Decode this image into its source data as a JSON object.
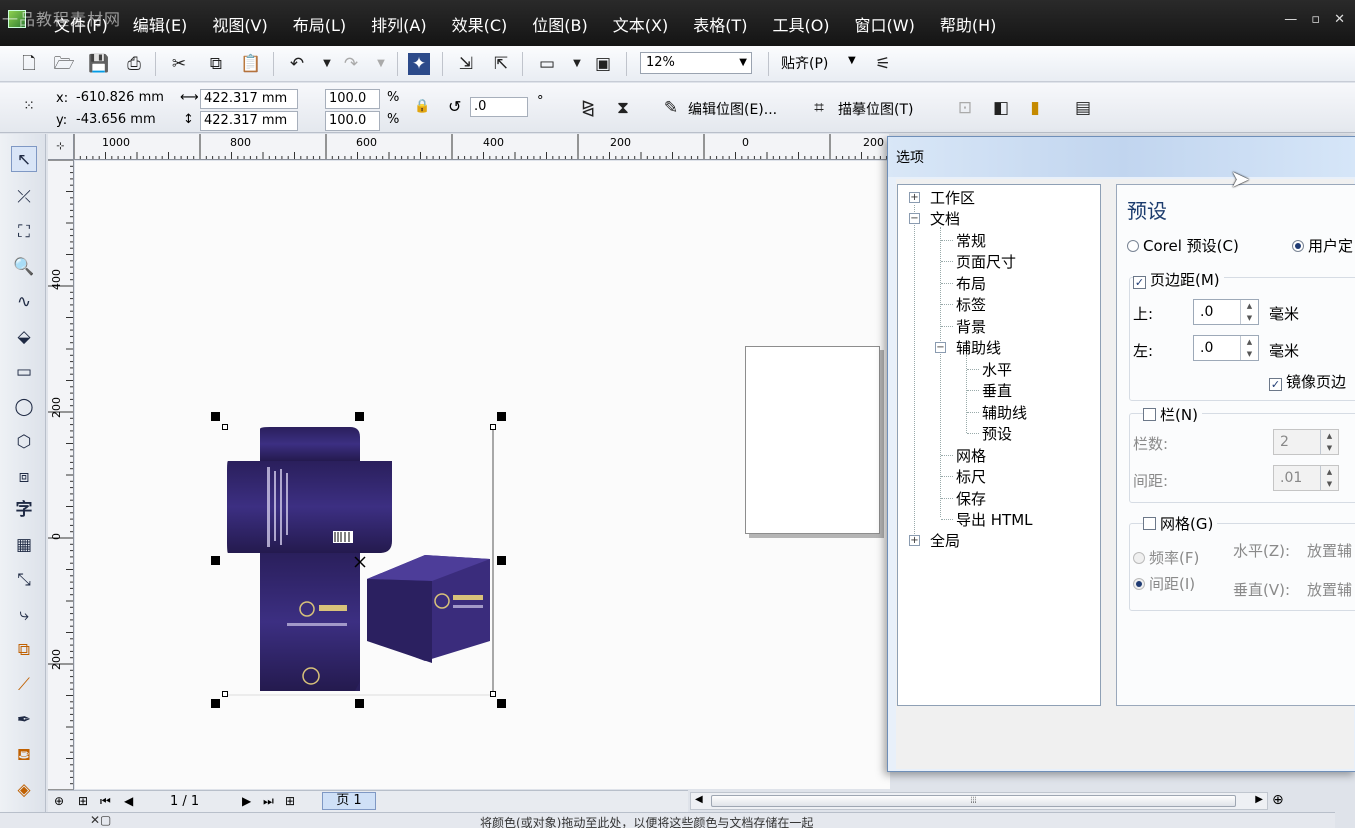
{
  "menubar": {
    "watermark": "一品教程素材网",
    "items": [
      "文件(F)",
      "编辑(E)",
      "视图(V)",
      "布局(L)",
      "排列(A)",
      "效果(C)",
      "位图(B)",
      "文本(X)",
      "表格(T)",
      "工具(O)",
      "窗口(W)",
      "帮助(H)"
    ]
  },
  "toolbar": {
    "zoom": "12%",
    "snap_label": "贴齐(P)"
  },
  "propbar": {
    "x_label": "x:",
    "x_value": "-610.826 mm",
    "y_label": "y:",
    "y_value": "-43.656 mm",
    "width_value": "422.317 mm",
    "height_value": "422.317 mm",
    "scale_w": "100.0",
    "scale_h": "100.0",
    "percent": "%",
    "rotation": ".0",
    "degree": "°",
    "edit_bitmap": "编辑位图(E)...",
    "trace_bitmap": "描摹位图(T)"
  },
  "ruler_h": {
    "labels": [
      "1000",
      "800",
      "600",
      "400",
      "200",
      "0",
      "200"
    ]
  },
  "ruler_v": {
    "labels": [
      "400",
      "200",
      "0",
      "200"
    ]
  },
  "pagenav": {
    "page_count": "1 / 1",
    "page_tab": "页 1"
  },
  "statusbar": {
    "hint": "将颜色(或对象)拖动至此处，以便将这些颜色与文档存储在一起"
  },
  "dialog": {
    "title": "选项",
    "tree": {
      "workspace": "工作区",
      "document": "文档",
      "general": "常规",
      "page_size": "页面尺寸",
      "layout": "布局",
      "label": "标签",
      "background": "背景",
      "guidelines": "辅助线",
      "horizontal": "水平",
      "vertical": "垂直",
      "guides": "辅助线",
      "presets": "预设",
      "grid": "网格",
      "rulers": "标尺",
      "save": "保存",
      "export_html": "导出 HTML",
      "global": "全局"
    },
    "panel": {
      "title": "预设",
      "corel_preset": "Corel 预设(C)",
      "user_defined": "用户定",
      "margins": "页边距(M)",
      "top_label": "上:",
      "top_value": ".0",
      "left_label": "左:",
      "left_value": ".0",
      "unit": "毫米",
      "mirror_margins": "镜像页边",
      "columns": "栏(N)",
      "col_count_label": "栏数:",
      "col_count_value": "2",
      "spacing_label": "间距:",
      "spacing_value": ".01",
      "grid": "网格(G)",
      "frequency": "频率(F)",
      "spacing": "间距(I)",
      "horiz_label": "水平(Z):",
      "vert_label": "垂直(V):",
      "place_guide": "放置辅",
      "place_guide2": "放置辅"
    }
  },
  "colors": {
    "menubar": "#1a1a1a",
    "box_purple": "#2f2466",
    "dialog_title": "#c8daf0",
    "accent": "#1c3c6e"
  }
}
